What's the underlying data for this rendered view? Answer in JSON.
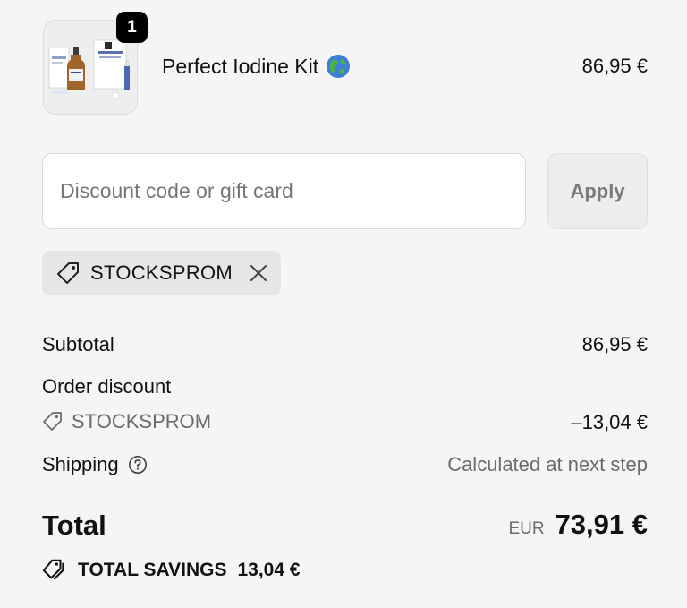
{
  "cart": {
    "quantity": "1",
    "product_name": "Perfect Iodine Kit",
    "product_price": "86,95 €",
    "product_image_icon": "product-bottles-image",
    "flag_icon": "globe-emoji-icon"
  },
  "discount": {
    "placeholder": "Discount code or gift card",
    "value": "",
    "apply_label": "Apply",
    "applied_code": "STOCKSPROM"
  },
  "summary": {
    "subtotal_label": "Subtotal",
    "subtotal_value": "86,95 €",
    "order_discount_label": "Order discount",
    "discount_code": "STOCKSPROM",
    "discount_value": "–13,04 €",
    "shipping_label": "Shipping",
    "shipping_value": "Calculated at next step",
    "total_label": "Total",
    "currency": "EUR",
    "total_value": "73,91 €",
    "savings_label": "TOTAL SAVINGS",
    "savings_value": "13,04 €"
  },
  "colors": {
    "background": "#f5f5f5",
    "badge": "#000000",
    "chip": "#e6e6e6",
    "muted_text": "#6b6b6b"
  }
}
